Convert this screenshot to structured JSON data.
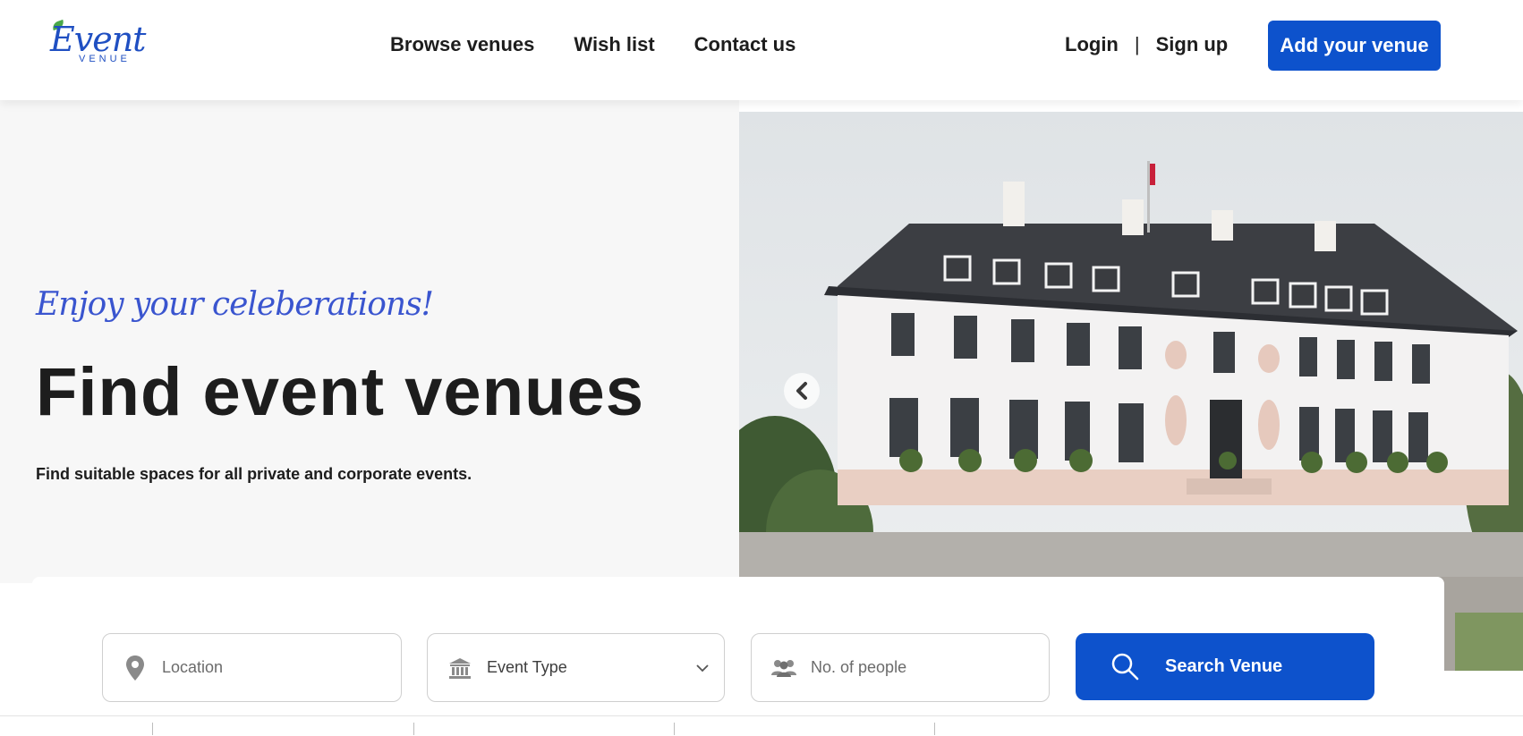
{
  "brand": {
    "logo_word": "Event",
    "logo_sub": "VENUE",
    "logo_icon": "leaf-logo-icon",
    "primary_color": "#0d52cc",
    "tagline_color": "#3a55cf"
  },
  "nav": {
    "items": [
      {
        "label": "Browse venues"
      },
      {
        "label": "Wish list"
      },
      {
        "label": "Contact us"
      }
    ]
  },
  "auth": {
    "login": "Login",
    "separator": "|",
    "signup": "Sign up"
  },
  "cta": {
    "add_venue": "Add your venue"
  },
  "hero": {
    "tagline": "Enjoy your celeberations!",
    "headline": "Find event venues",
    "subline": "Find suitable spaces for all private and corporate events.",
    "carousel_prev_icon": "chevron-left-icon"
  },
  "search": {
    "location": {
      "placeholder": "Location",
      "icon": "map-pin-icon"
    },
    "event_type": {
      "value": "Event Type",
      "icon": "bank-icon",
      "chevron": "chevron-down-icon"
    },
    "people": {
      "placeholder": "No. of people",
      "icon": "people-icon"
    },
    "button": {
      "label": "Search Venue",
      "icon": "search-icon"
    }
  }
}
